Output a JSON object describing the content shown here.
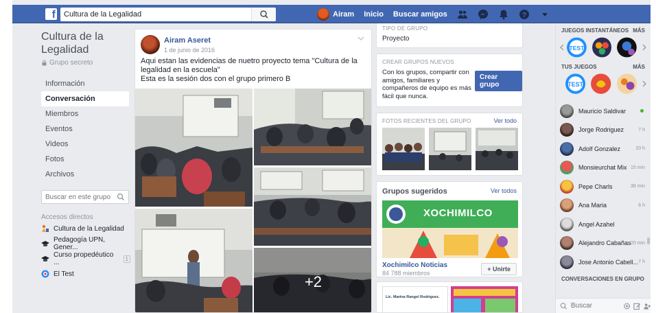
{
  "topbar": {
    "logo": "f",
    "search_value": "Cultura de la Legalidad",
    "user_name": "Airam",
    "home": "Inicio",
    "find_friends": "Buscar amigos"
  },
  "group": {
    "title": "Cultura de la Legalidad",
    "privacy": "Grupo secreto",
    "nav": [
      "Información",
      "Conversación",
      "Miembros",
      "Eventos",
      "Videos",
      "Fotos",
      "Archivos"
    ],
    "search_placeholder": "Buscar en este grupo",
    "shortcuts_title": "Accesos directos",
    "shortcuts": [
      {
        "label": "Cultura de la Legalidad"
      },
      {
        "label": "Pedagogía UPN, Gener..."
      },
      {
        "label": "Curso propedéutico ...",
        "badge": "1"
      },
      {
        "label": "El Test"
      }
    ]
  },
  "post": {
    "author": "Airam Aseret",
    "date": "1 de junio de 2016",
    "text_line1": "Aqui estan las evidencias de nuetro proyecto tema \"Cultura de la legalidad en la escuela\"",
    "text_line2": "Esta es la sesión dos con el grupo primero B",
    "more_photos": "+2"
  },
  "mid": {
    "type_label": "Tipo de grupo",
    "type_value": "Proyecto",
    "create_label": "Crear grupos nuevos",
    "create_text": "Con los grupos, compartir con amigos, familiares y compañeros de equipo es más fácil que nunca.",
    "create_button": "Crear grupo",
    "photos_label": "Fotos recientes del grupo",
    "see_all": "Ver todo",
    "suggested_title": "Grupos sugeridos",
    "see_all_2": "Ver todos",
    "suggested_name": "Xochimilco Noticias",
    "suggested_members": "84 788 miembros",
    "join_button": "+ Unirte",
    "banner_word": "XOCHIMILCO",
    "next_card_text": "Lic. Marina Rangel Rodriguez."
  },
  "rail": {
    "games_title": "JUEGOS INSTANTÁNEOS",
    "more": "MÁS",
    "your_games": "TUS JUEGOS",
    "more2": "MÁS",
    "test_label": "TEST",
    "contacts": [
      {
        "name": "Mauricio Saldivar",
        "time": "",
        "online": true
      },
      {
        "name": "Jorge Rodriguez",
        "time": "7 h"
      },
      {
        "name": "Adolf Gonzalez",
        "time": "20 h"
      },
      {
        "name": "Monsieurchat Mix",
        "time": "15 min"
      },
      {
        "name": "Pepe Charls",
        "time": "38 min"
      },
      {
        "name": "Ana Maria",
        "time": "6 h"
      },
      {
        "name": "Angel Azahel",
        "time": ""
      },
      {
        "name": "Alejandro Cabañas",
        "time": "20 min"
      },
      {
        "name": "Jose Antonio Cabell...",
        "time": "7 h"
      }
    ],
    "group_convos": "CONVERSACIONES EN GRUPO",
    "search_placeholder": "Buscar"
  }
}
